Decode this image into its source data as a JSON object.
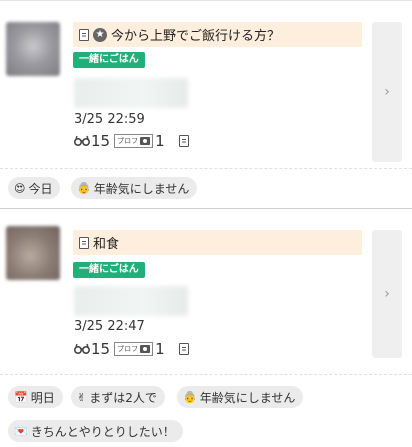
{
  "posts": [
    {
      "title": "今から上野でご飯行ける方？",
      "tag": "一緒にごはん",
      "timestamp": "3/25 22:59",
      "views": "15",
      "prof_label": "プロフ",
      "photo_count": "1",
      "has_star": true,
      "chips": [
        {
          "emoji": "😍",
          "label": "今日"
        },
        {
          "emoji": "👵",
          "label": "年齢気にしません"
        }
      ]
    },
    {
      "title": "和食",
      "tag": "一緒にごはん",
      "timestamp": "3/25 22:47",
      "views": "15",
      "prof_label": "プロフ",
      "photo_count": "1",
      "has_star": false,
      "chips": [
        {
          "emoji": "📅",
          "label": "明日"
        },
        {
          "emoji": "✌",
          "label": "まずは2人で"
        },
        {
          "emoji": "👵",
          "label": "年齢気にしません"
        },
        {
          "emoji": "💌",
          "label": "きちんとやりとりしたい！"
        }
      ]
    }
  ],
  "colors": {
    "title_bg": "#fdeedd",
    "tag_green": "#22b07a",
    "chip_bg": "#ebebeb",
    "arrow_panel": "#efefef"
  },
  "icons": {
    "memo": "memo-icon",
    "star": "star-circle-icon",
    "glasses": "glasses-icon",
    "camera": "camera-icon",
    "chevron": "chevron-right-icon"
  }
}
